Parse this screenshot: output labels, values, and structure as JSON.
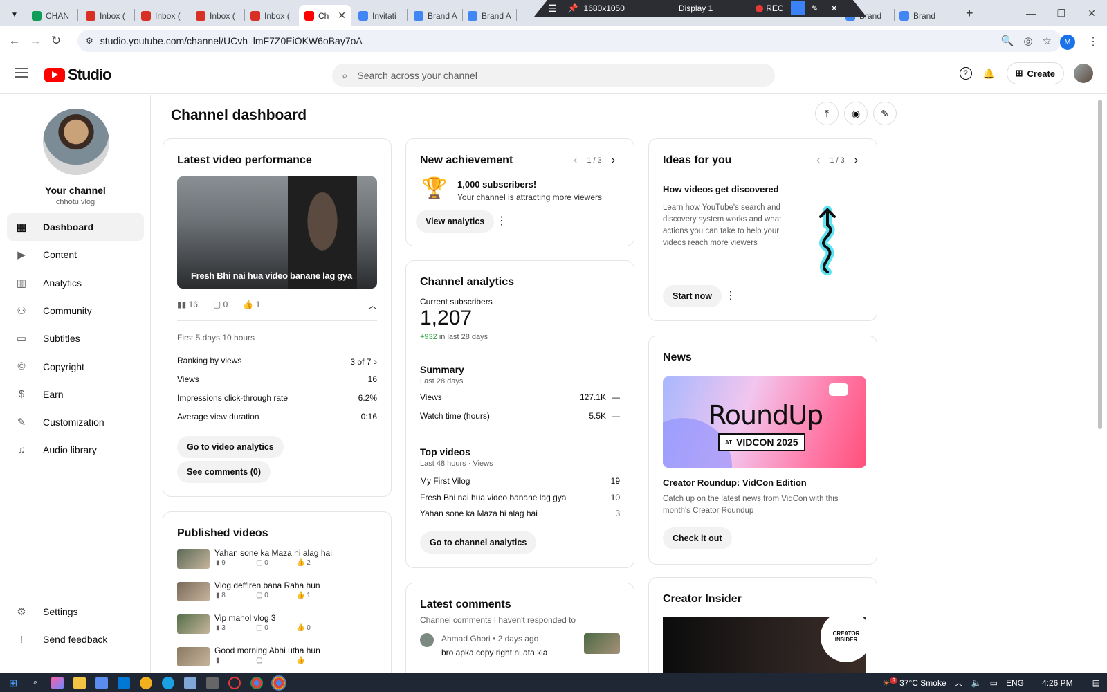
{
  "browser": {
    "tabs": [
      {
        "label": "CHAN",
        "fav": "sheets",
        "color": "#0f9d58"
      },
      {
        "label": "Inbox (",
        "fav": "gmail",
        "color": "#d93025"
      },
      {
        "label": "Inbox (",
        "fav": "gmail",
        "color": "#d93025"
      },
      {
        "label": "Inbox (",
        "fav": "gmail",
        "color": "#d93025"
      },
      {
        "label": "Inbox (",
        "fav": "gmail",
        "color": "#d93025"
      },
      {
        "label": "Ch",
        "fav": "youtube",
        "color": "#ff0000",
        "active": true
      },
      {
        "label": "Invitati",
        "fav": "google",
        "color": "#4285f4"
      },
      {
        "label": "Brand A",
        "fav": "google",
        "color": "#4285f4"
      },
      {
        "label": "Brand A",
        "fav": "google",
        "color": "#4285f4"
      },
      {
        "label": "Brand",
        "fav": "google",
        "color": "#4285f4"
      },
      {
        "label": "Brand",
        "fav": "google",
        "color": "#4285f4"
      }
    ],
    "url": "studio.youtube.com/channel/UCvh_lmF7Z0EiOKW6oBay7oA",
    "profile_initial": "M",
    "recording_overlay": {
      "resolution": "1680x1050",
      "display": "Display 1",
      "rec": "REC"
    }
  },
  "header": {
    "logo_text": "Studio",
    "search_placeholder": "Search across your channel",
    "create_label": "Create"
  },
  "sidebar": {
    "channel_title": "Your channel",
    "channel_handle": "chhotu vlog",
    "items": [
      {
        "label": "Dashboard",
        "icon": "dashboard-icon",
        "glyph": "▦",
        "active": true
      },
      {
        "label": "Content",
        "icon": "content-icon",
        "glyph": "▶"
      },
      {
        "label": "Analytics",
        "icon": "analytics-icon",
        "glyph": "▥"
      },
      {
        "label": "Community",
        "icon": "community-icon",
        "glyph": "⚇"
      },
      {
        "label": "Subtitles",
        "icon": "subtitles-icon",
        "glyph": "▭"
      },
      {
        "label": "Copyright",
        "icon": "copyright-icon",
        "glyph": "©"
      },
      {
        "label": "Earn",
        "icon": "earn-icon",
        "glyph": "$"
      },
      {
        "label": "Customization",
        "icon": "customization-icon",
        "glyph": "✎"
      },
      {
        "label": "Audio library",
        "icon": "audio-library-icon",
        "glyph": "♫"
      }
    ],
    "bottom_items": [
      {
        "label": "Settings",
        "icon": "settings-icon",
        "glyph": "⚙"
      },
      {
        "label": "Send feedback",
        "icon": "feedback-icon",
        "glyph": "!"
      }
    ]
  },
  "main": {
    "page_title": "Channel dashboard",
    "latest_video": {
      "title": "Latest video performance",
      "video_title": "Fresh Bhi nai hua video banane lag gya",
      "views": "16",
      "comments": "0",
      "likes": "1",
      "period": "First 5 days 10 hours",
      "stats": [
        {
          "label": "Ranking by views",
          "value": "3 of 7"
        },
        {
          "label": "Views",
          "value": "16"
        },
        {
          "label": "Impressions click-through rate",
          "value": "6.2%"
        },
        {
          "label": "Average view duration",
          "value": "0:16"
        }
      ],
      "btn_analytics": "Go to video analytics",
      "btn_comments": "See comments (0)"
    },
    "published": {
      "title": "Published videos",
      "videos": [
        {
          "title": "Yahan sone ka Maza hi alag hai",
          "views": "9",
          "comments": "0",
          "likes": "2"
        },
        {
          "title": "Vlog deffiren bana Raha hun",
          "views": "8",
          "comments": "0",
          "likes": "1"
        },
        {
          "title": "Vip mahol vlog 3",
          "views": "3",
          "comments": "0",
          "likes": "0"
        },
        {
          "title": "Good morning Abhi utha hun",
          "views": "",
          "comments": "",
          "likes": ""
        }
      ]
    },
    "achievement": {
      "title": "New achievement",
      "pager": "1 / 3",
      "headline": "1,000 subscribers!",
      "sub": "Your channel is attracting more viewers",
      "btn": "View analytics"
    },
    "analytics": {
      "title": "Channel analytics",
      "subs_label": "Current subscribers",
      "subs_value": "1,207",
      "subs_delta": "+932",
      "subs_delta_suffix": "in last 28 days",
      "summary_title": "Summary",
      "summary_period": "Last 28 days",
      "summary_rows": [
        {
          "label": "Views",
          "value": "127.1K",
          "trend": "—"
        },
        {
          "label": "Watch time (hours)",
          "value": "5.5K",
          "trend": "—"
        }
      ],
      "top_title": "Top videos",
      "top_period": "Last 48 hours · Views",
      "top_rows": [
        {
          "label": "My First Vilog",
          "value": "19"
        },
        {
          "label": "Fresh Bhi nai hua video banane lag gya",
          "value": "10"
        },
        {
          "label": "Yahan sone ka Maza hi alag hai",
          "value": "3"
        }
      ],
      "btn": "Go to channel analytics",
      "delta_color": "#2ba640"
    },
    "latest_comments": {
      "title": "Latest comments",
      "sub": "Channel comments I haven't responded to",
      "author": "Ahmad Ghori",
      "time": "• 2 days ago",
      "text": "bro apka copy right ni ata kia"
    },
    "ideas": {
      "title": "Ideas for you",
      "pager": "1 / 3",
      "headline": "How videos get discovered",
      "body": "Learn how YouTube's search and discovery system works and what actions you can take to help your videos reach more viewers",
      "btn": "Start now"
    },
    "news": {
      "title": "News",
      "banner_line1": "RoundUp",
      "banner_at": "AT",
      "banner_line2": "VIDCON 2025",
      "headline": "Creator Roundup: VidCon Edition",
      "body": "Catch up on the latest news from VidCon with this month's Creator Roundup",
      "btn": "Check it out"
    },
    "insider": {
      "title": "Creator Insider",
      "badge_line1": "CREATOR",
      "badge_line2": "INSIDER"
    }
  },
  "taskbar": {
    "weather": "37°C  Smoke",
    "weather_badge": "3",
    "lang": "ENG",
    "time": "4:26 PM"
  }
}
